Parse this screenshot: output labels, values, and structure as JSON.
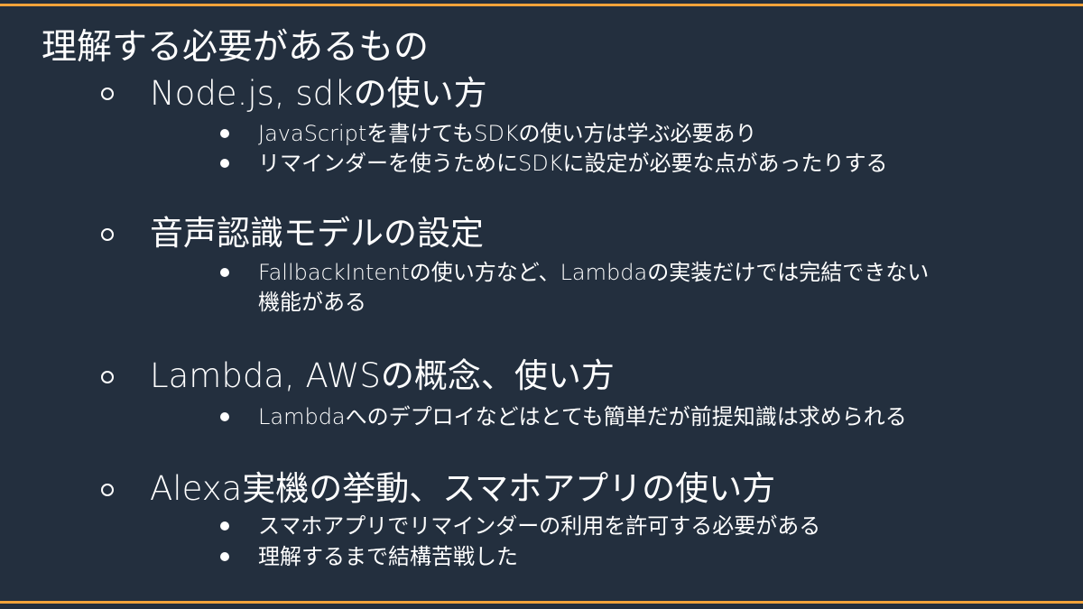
{
  "slide": {
    "title": "理解する必要があるもの",
    "sections": [
      {
        "heading": "Node.js, sdkの使い方",
        "items": [
          "JavaScriptを書けてもSDKの使い方は学ぶ必要あり",
          "リマインダーを使うためにSDKに設定が必要な点があったりする"
        ]
      },
      {
        "heading": "音声認識モデルの設定",
        "items": [
          {
            "line1": "FallbackIntentの使い方など、Lambdaの実装だけでは完結できない",
            "line2": "機能がある"
          }
        ]
      },
      {
        "heading": "Lambda, AWSの概念、使い方",
        "items": [
          "Lambdaへのデプロイなどはとても簡単だが前提知識は求められる"
        ]
      },
      {
        "heading": "Alexa実機の挙動、スマホアプリの使い方",
        "items": [
          "スマホアプリでリマインダーの利用を許可する必要がある",
          "理解するまで結構苦戦した"
        ]
      }
    ]
  },
  "colors": {
    "background": "#232f3e",
    "accent": "#f2a33a",
    "text": "#ffffff"
  }
}
